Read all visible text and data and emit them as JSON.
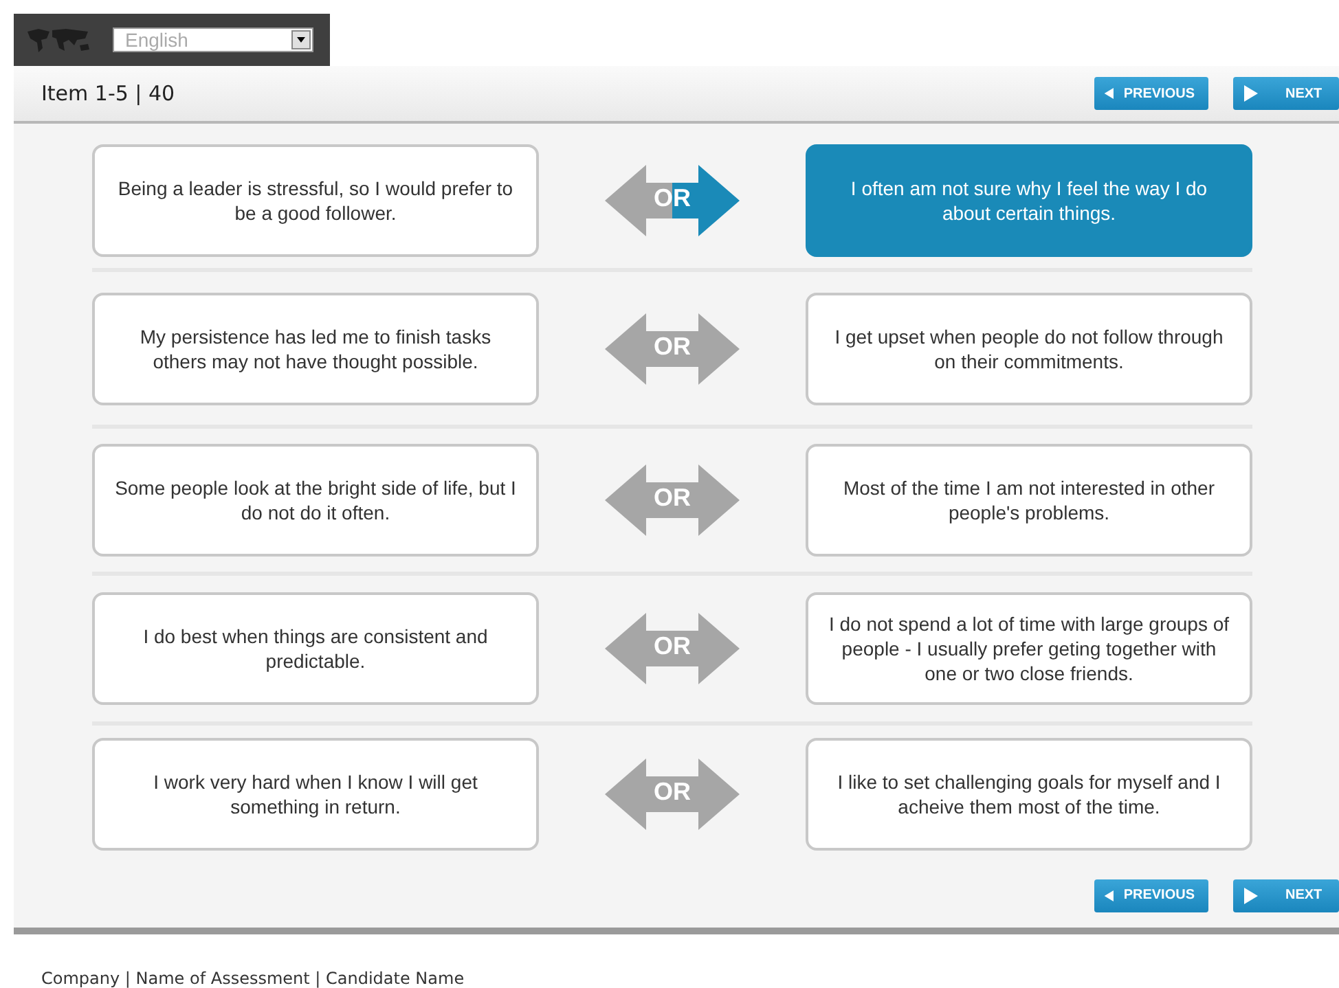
{
  "language_select": {
    "value": "English"
  },
  "header": {
    "item_counter": "Item 1-5 | 40",
    "previous": "PREVIOUS",
    "next": "NEXT"
  },
  "pairs": [
    {
      "or_label": "OR",
      "left": {
        "text": "Being a leader is stressful, so I would prefer to be a good follower.",
        "selected": false
      },
      "right": {
        "text": "I often am not sure why I feel the way I do about certain things.",
        "selected": true
      }
    },
    {
      "or_label": "OR",
      "left": {
        "text": "My persistence has led me to finish tasks others may not have thought possible.",
        "selected": false
      },
      "right": {
        "text": "I get upset when people do not follow through on their commitments.",
        "selected": false
      }
    },
    {
      "or_label": "OR",
      "left": {
        "text": "Some people look at the bright side of life, but I do not do it often.",
        "selected": false
      },
      "right": {
        "text": "Most of the time I am not interested in other people's problems.",
        "selected": false
      }
    },
    {
      "or_label": "OR",
      "left": {
        "text": "I do best when things are consistent and predictable.",
        "selected": false
      },
      "right": {
        "text": "I do not spend a lot of time with large groups of people - I usually prefer geting together with one or two close friends.",
        "selected": false
      }
    },
    {
      "or_label": "OR",
      "left": {
        "text": "I work very hard when I know I will get something in return.",
        "selected": false
      },
      "right": {
        "text": "I like to set challenging goals for myself and I acheive them most of the time.",
        "selected": false
      }
    }
  ],
  "bottom_nav": {
    "previous": "PREVIOUS",
    "next": "NEXT"
  },
  "footer": {
    "text": "Company | Name of Assessment | Candidate Name"
  }
}
